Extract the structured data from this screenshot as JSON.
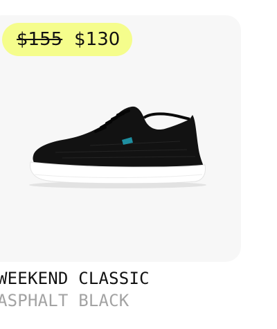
{
  "product": {
    "original_price": "$155",
    "sale_price": "$130",
    "name": "WEEKEND CLASSIC",
    "color": "ASPHALT BLACK",
    "image_icon": "sneaker-icon"
  },
  "colors": {
    "badge_bg": "#f5fd8c",
    "panel_bg": "#f7f7f7",
    "name_text": "#111111",
    "color_text": "#a3a3a3",
    "shoe_upper": "#111111",
    "shoe_sole": "#ffffff",
    "accent_tab": "#1e8ea0"
  }
}
